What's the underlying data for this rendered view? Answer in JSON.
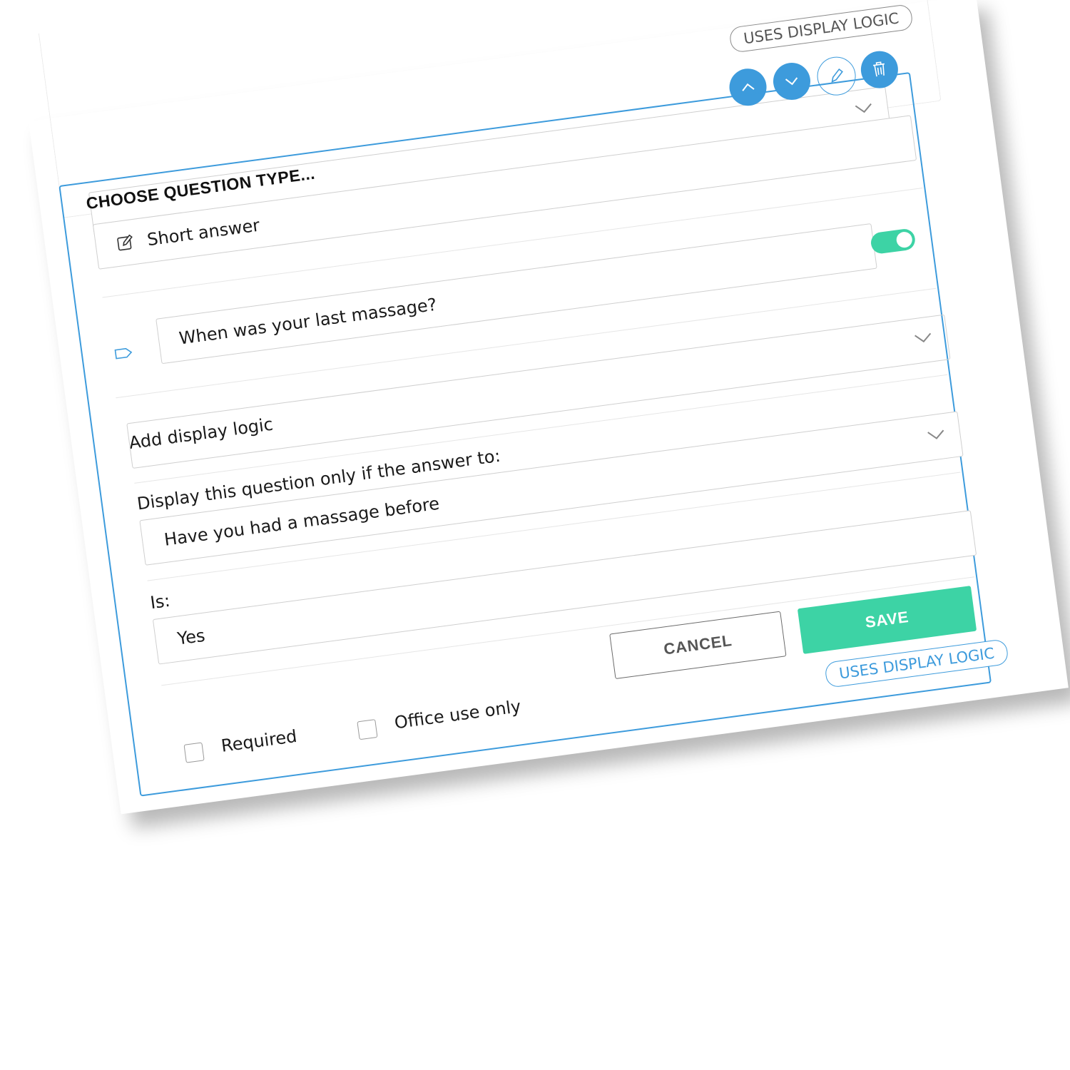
{
  "header": {
    "uses_display_logic_top": "USES DISPLAY LOGIC",
    "controls": {
      "move_up_icon": "chevron-up-icon",
      "move_down_icon": "chevron-down-icon",
      "edit_icon": "pencil-icon",
      "delete_icon": "trash-icon"
    }
  },
  "question": {
    "section_title": "CHOOSE QUESTION TYPE...",
    "type_value": "Short answer",
    "type_icon": "edit-icon",
    "prompt_value": "When was your last massage?",
    "label_icon": "tag-icon",
    "toggle_on": true
  },
  "display_logic": {
    "add_label": "Add display logic",
    "condition_label": "Display this question only if the answer to:",
    "question_value": "Have you had a massage before",
    "is_label": "Is:",
    "is_value": "Yes"
  },
  "actions": {
    "cancel_label": "CANCEL",
    "save_label": "SAVE"
  },
  "options": {
    "required_label": "Required",
    "office_use_label": "Office use only"
  },
  "footer": {
    "uses_display_logic_bottom": "USES DISPLAY LOGIC"
  },
  "colors": {
    "accent_blue": "#3d9bdc",
    "accent_green": "#3dd3a5",
    "border_grey": "#cfcfcf",
    "text": "#1a1a1a"
  }
}
